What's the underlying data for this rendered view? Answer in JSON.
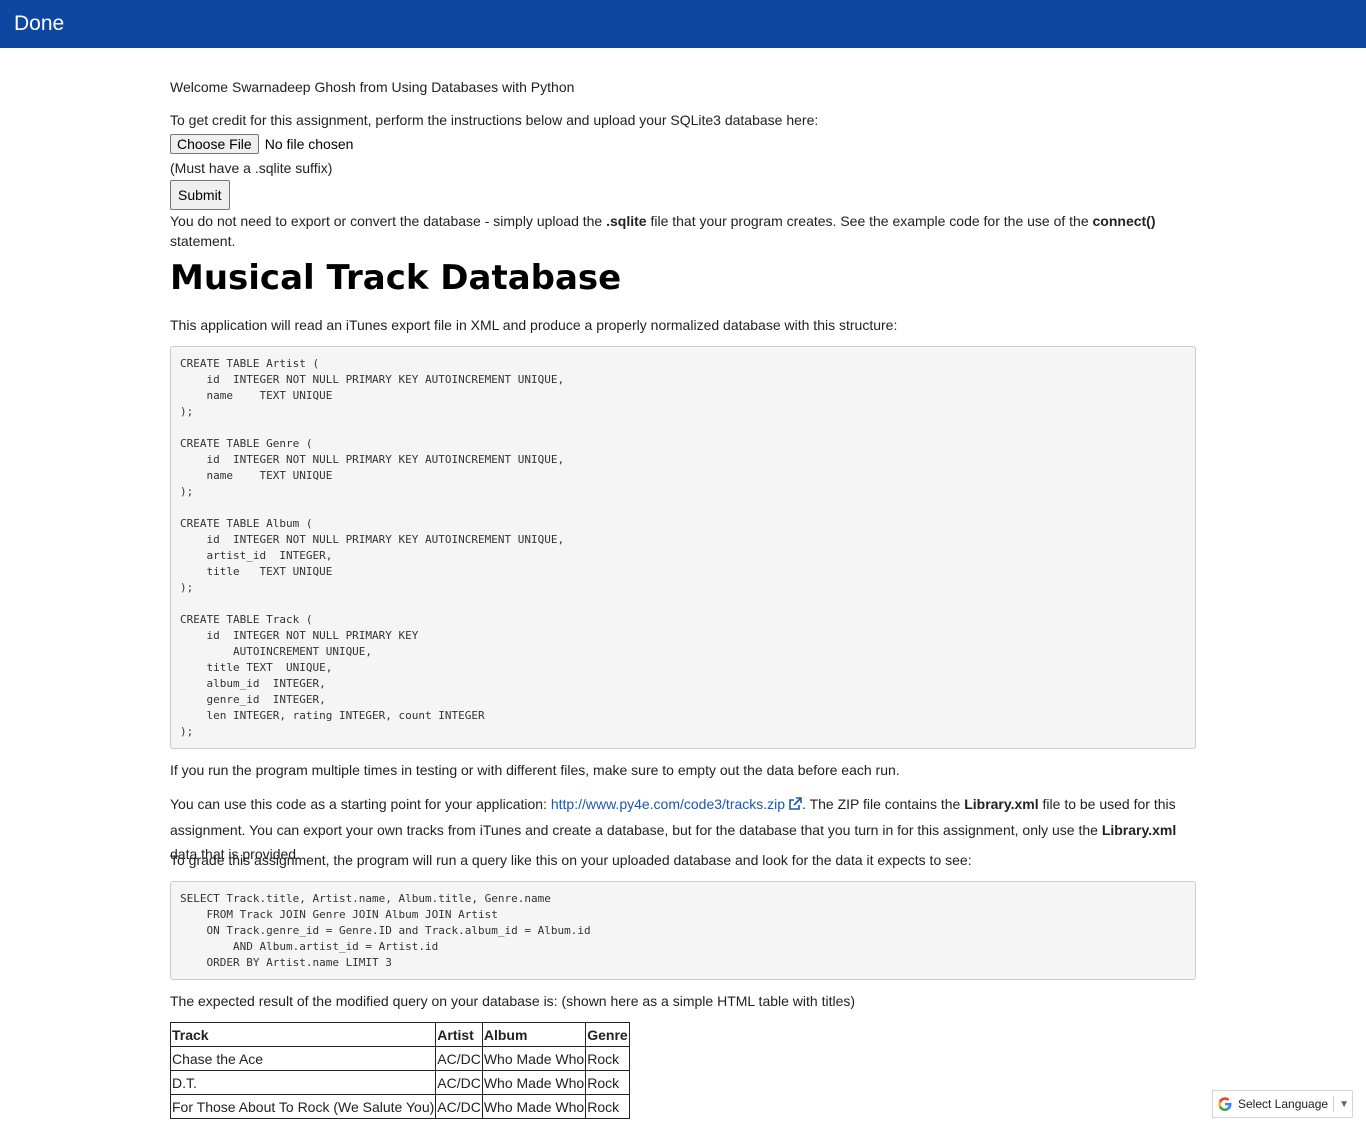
{
  "topbar": {
    "done_label": "Done"
  },
  "welcome": "Welcome Swarnadeep Ghosh from Using Databases with Python",
  "upload": {
    "instructions": "To get credit for this assignment, perform the instructions below and upload your SQLite3 database here:",
    "choose_file_label": "Choose File",
    "file_status": "No file chosen",
    "suffix_note": "(Must have a .sqlite suffix)",
    "submit_label": "Submit",
    "note_part1": "You do not need to export or convert the database - simply upload the ",
    "note_bold1": ".sqlite",
    "note_part2": " file that your program creates. See the example code for the use of the ",
    "note_bold2": "connect()",
    "note_part3": " statement."
  },
  "heading": "Musical Track Database",
  "intro": "This application will read an iTunes export file in XML and produce a properly normalized database with this structure:",
  "schema_code": "CREATE TABLE Artist (\n    id  INTEGER NOT NULL PRIMARY KEY AUTOINCREMENT UNIQUE,\n    name    TEXT UNIQUE\n);\n\nCREATE TABLE Genre (\n    id  INTEGER NOT NULL PRIMARY KEY AUTOINCREMENT UNIQUE,\n    name    TEXT UNIQUE\n);\n\nCREATE TABLE Album (\n    id  INTEGER NOT NULL PRIMARY KEY AUTOINCREMENT UNIQUE,\n    artist_id  INTEGER,\n    title   TEXT UNIQUE\n);\n\nCREATE TABLE Track (\n    id  INTEGER NOT NULL PRIMARY KEY\n        AUTOINCREMENT UNIQUE,\n    title TEXT  UNIQUE,\n    album_id  INTEGER,\n    genre_id  INTEGER,\n    len INTEGER, rating INTEGER, count INTEGER\n);",
  "empty_note": "If you run the program multiple times in testing or with different files, make sure to empty out the data before each run.",
  "code_note": {
    "part1": "You can use this code as a starting point for your application: ",
    "link": "http://www.py4e.com/code3/tracks.zip",
    "part2": ". The ZIP file contains the ",
    "bold1": "Library.xml",
    "part3": " file to be used for this assignment. You can export your own tracks from iTunes and create a database, but for the database that you turn in for this assignment, only use the ",
    "bold2": "Library.xml",
    "part4": " data that is provided."
  },
  "grade_note": "To grade this assignment, the program will run a query like this on your uploaded database and look for the data it expects to see:",
  "query_code": "SELECT Track.title, Artist.name, Album.title, Genre.name\n    FROM Track JOIN Genre JOIN Album JOIN Artist\n    ON Track.genre_id = Genre.ID and Track.album_id = Album.id\n        AND Album.artist_id = Artist.id\n    ORDER BY Artist.name LIMIT 3",
  "expected_note": "The expected result of the modified query on your database is: (shown here as a simple HTML table with titles)",
  "result_table": {
    "headers": [
      "Track",
      "Artist",
      "Album",
      "Genre"
    ],
    "rows": [
      [
        "Chase the Ace",
        "AC/DC",
        "Who Made Who",
        "Rock"
      ],
      [
        "D.T.",
        "AC/DC",
        "Who Made Who",
        "Rock"
      ],
      [
        "For Those About To Rock (We Salute You)",
        "AC/DC",
        "Who Made Who",
        "Rock"
      ]
    ]
  },
  "translate": {
    "label": "Select Language",
    "icon": "google-g-icon"
  },
  "colors": {
    "topbar": "#0d47a1",
    "link": "#1a56b8"
  }
}
